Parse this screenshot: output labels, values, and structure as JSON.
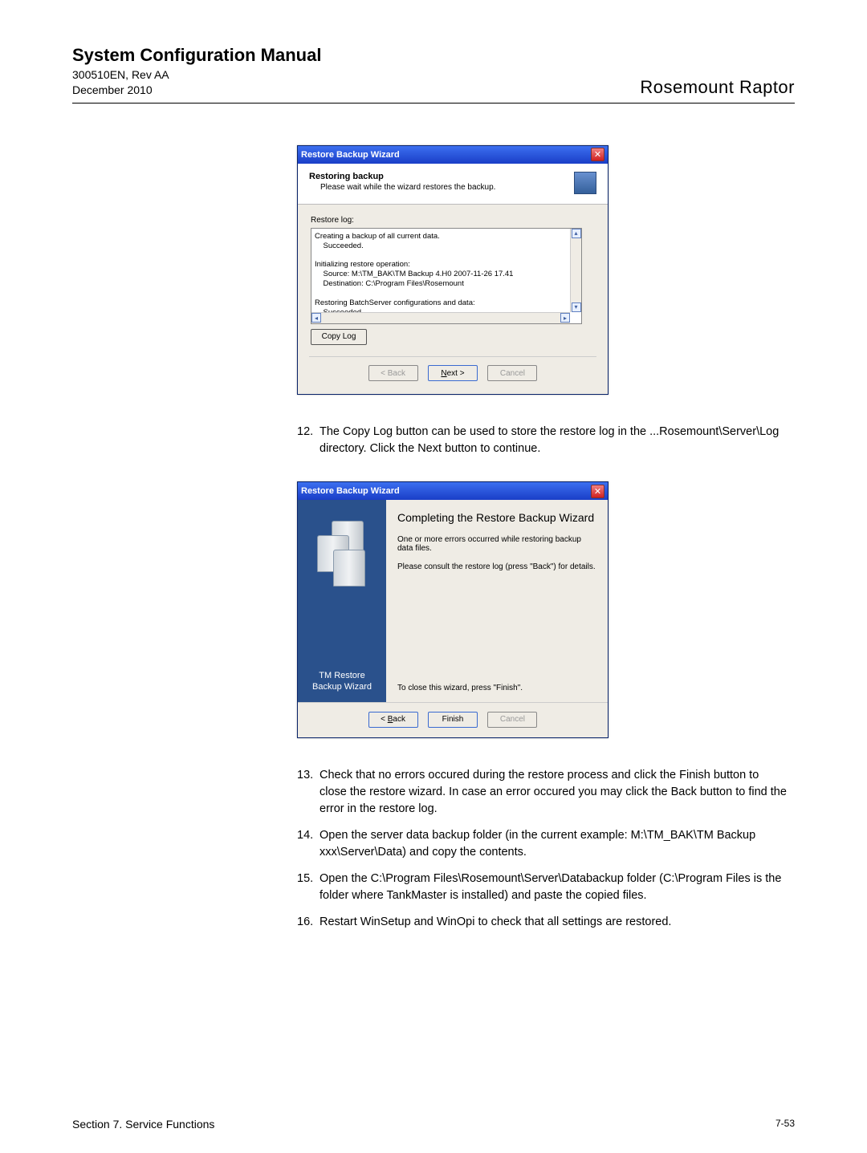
{
  "header": {
    "title": "System Configuration Manual",
    "doc_id": "300510EN, Rev AA",
    "date": "December 2010",
    "product": "Rosemount Raptor"
  },
  "dlg1": {
    "title": "Restore Backup Wizard",
    "head_title": "Restoring backup",
    "head_sub": "Please wait while the wizard restores the backup.",
    "log_label": "Restore log:",
    "log_text": "Creating a backup of all current data.\n    Succeeded.\n\nInitializing restore operation:\n    Source: M:\\TM_BAK\\TM Backup 4.H0 2007-11-26 17.41\n    Destination: C:\\Program Files\\Rosemount\n\nRestoring BatchServer configurations and data:\n    Succeeded.\n\nShutting down TankMaster",
    "copy_log": "Copy Log",
    "back": "< Back",
    "next": "Next >",
    "cancel": "Cancel"
  },
  "step12": {
    "num": "12.",
    "text": "The Copy Log button can be used to store the restore log in the ...Rosemount\\Server\\Log directory. Click the Next button to continue."
  },
  "dlg2": {
    "title": "Restore Backup Wizard",
    "left_caption": "TM Restore\nBackup Wizard",
    "rp_title": "Completing the Restore Backup Wizard",
    "rp_err": "One or more errors occurred while restoring backup data files.",
    "rp_consult": "Please consult the restore log (press \"Back\") for details.",
    "rp_close": "To close this wizard, press \"Finish\".",
    "back": "< Back",
    "finish": "Finish",
    "cancel": "Cancel"
  },
  "steps_after": [
    {
      "num": "13.",
      "text": "Check that no errors occured during the restore process and click the Finish button to close the restore wizard. In case an error occured you may click the Back button to find the error in the restore log."
    },
    {
      "num": "14.",
      "text": "Open the server data backup folder (in the current example: M:\\TM_BAK\\TM Backup xxx\\Server\\Data) and copy the contents."
    },
    {
      "num": "15.",
      "text": "Open the C:\\Program Files\\Rosemount\\Server\\Databackup folder (C:\\Program Files is the folder where TankMaster is installed) and paste the copied files."
    },
    {
      "num": "16.",
      "text": "Restart WinSetup and WinOpi to check that all settings are restored."
    }
  ],
  "footer": {
    "section": "Section 7. Service Functions",
    "page": "7-53"
  }
}
